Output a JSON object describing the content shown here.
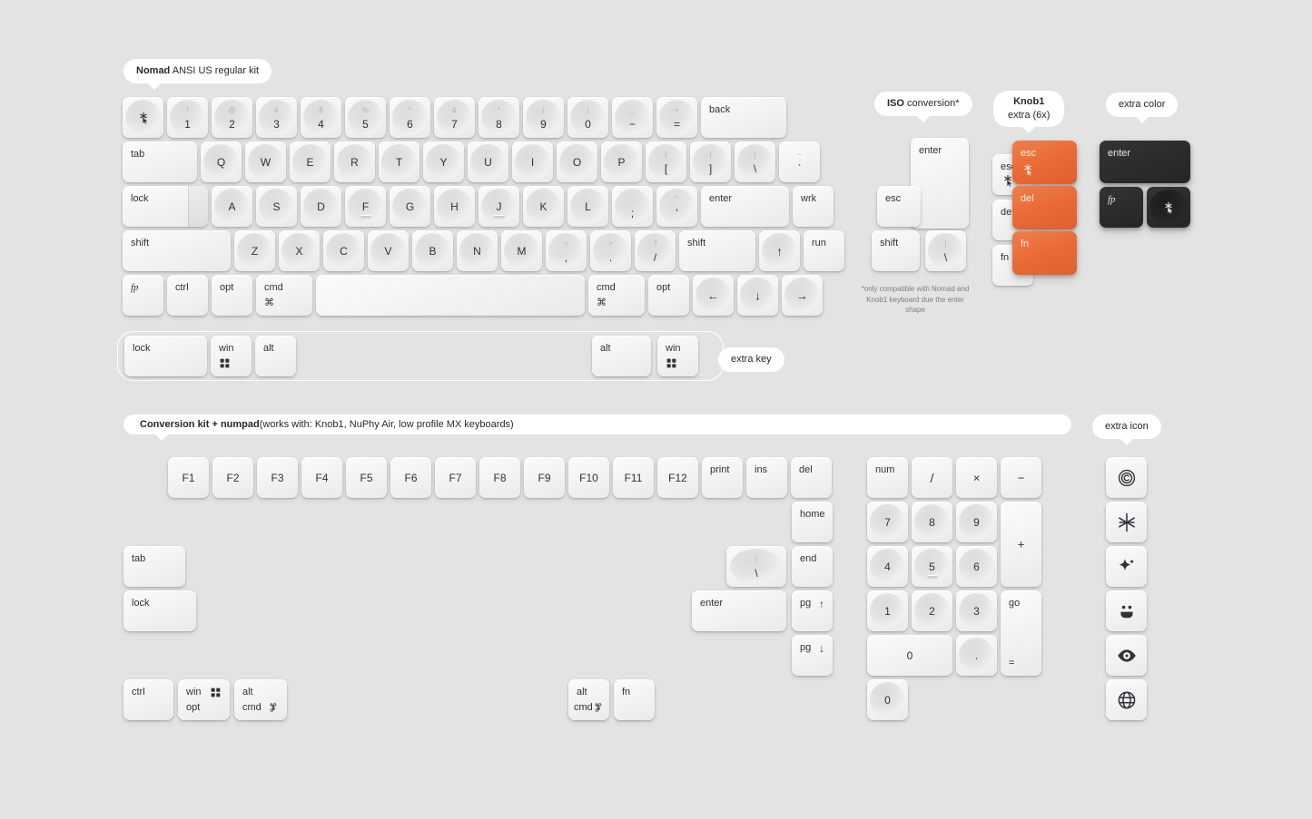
{
  "theme": {
    "background": "#e3e3e3",
    "keycap_light": "#f2f2f2",
    "keycap_orange": "#e96a37",
    "keycap_black": "#2c2c2c",
    "legend_color": "#2f3236",
    "sublegend_color": "#b4b4b4"
  },
  "sections": {
    "nomad": {
      "title_bold": "Nomad",
      "title_rest": " ANSI US regular kit"
    },
    "iso": {
      "title_bold": "ISO",
      "title_rest": " conversion*",
      "footnote": "*only compatible with Nomad and Knob1 keyboard due the enter shape"
    },
    "knob1": {
      "title_bold": "Knob1",
      "title_sub": "extra (6x)"
    },
    "extra_color": {
      "title": "extra color"
    },
    "extra_key": {
      "title": "extra key"
    },
    "extra_icon": {
      "title": "extra icon"
    },
    "conversion": {
      "title_bold": "Conversion kit + numpad",
      "title_rest": " (works with: Knob1, NuPhy Air, low profile MX keyboards)"
    }
  },
  "keys": {
    "esc": "esc",
    "tab": "tab",
    "lock": "lock",
    "shift": "shift",
    "ctrl": "ctrl",
    "opt": "opt",
    "cmd": "cmd",
    "cmd_sym": "⌘",
    "back": "back",
    "enter": "enter",
    "wrk": "wrk",
    "run": "run",
    "win": "win",
    "alt": "alt",
    "fn": "fn",
    "del": "del",
    "num": "num",
    "home": "home",
    "end": "end",
    "pg": "pg",
    "print": "print",
    "ins": "ins",
    "go": "go",
    "equals": "=",
    "plus": "+",
    "minus": "−",
    "multiply": "×",
    "divide": "/",
    "dot": ".",
    "zero": "0"
  },
  "number_row": [
    {
      "top": "!",
      "bottom": "1"
    },
    {
      "top": "@",
      "bottom": "2"
    },
    {
      "top": "#",
      "bottom": "3"
    },
    {
      "top": "$",
      "bottom": "4"
    },
    {
      "top": "%",
      "bottom": "5"
    },
    {
      "top": "^",
      "bottom": "6"
    },
    {
      "top": "&",
      "bottom": "7"
    },
    {
      "top": "*",
      "bottom": "8"
    },
    {
      "top": "(",
      "bottom": "9"
    },
    {
      "top": ")",
      "bottom": "0"
    },
    {
      "top": "_",
      "bottom": "−"
    },
    {
      "top": "+",
      "bottom": "="
    }
  ],
  "row_q": [
    "Q",
    "W",
    "E",
    "R",
    "T",
    "Y",
    "U",
    "I",
    "O",
    "P"
  ],
  "row_q_sym": [
    {
      "top": "{",
      "bottom": "["
    },
    {
      "top": "}",
      "bottom": "]"
    },
    {
      "top": "|",
      "bottom": "\\"
    }
  ],
  "row_q_extra": {
    "top": "~",
    "bottom": "`"
  },
  "row_a": [
    "A",
    "S",
    "D",
    "F",
    "G",
    "H",
    "J",
    "K",
    "L"
  ],
  "row_a_sym": [
    {
      "top": ":",
      "bottom": ";"
    },
    {
      "top": "\"",
      "bottom": "'"
    }
  ],
  "row_z": [
    "Z",
    "X",
    "C",
    "V",
    "B",
    "N",
    "M"
  ],
  "row_z_sym": [
    {
      "top": "<",
      "bottom": ","
    },
    {
      "top": ">",
      "bottom": "."
    },
    {
      "top": "?",
      "bottom": "/"
    }
  ],
  "arrows": {
    "up": "↑",
    "down": "↓",
    "left": "←",
    "right": "→"
  },
  "fkeys": [
    "F1",
    "F2",
    "F3",
    "F4",
    "F5",
    "F6",
    "F7",
    "F8",
    "F9",
    "F10",
    "F11",
    "F12"
  ],
  "numpad_digits": [
    "7",
    "8",
    "9",
    "4",
    "5",
    "6",
    "1",
    "2",
    "3"
  ],
  "icons": {
    "esc_glyph": "snowflake-cursor-icon",
    "win_glyph": "windows-squares-icon",
    "copyright": "copyright-icon",
    "asterisk": "asterisk-icon",
    "sparkle": "sparkle-icon",
    "smiley": "smiley-icon",
    "eye": "eye-icon",
    "globe": "globe-icon"
  }
}
